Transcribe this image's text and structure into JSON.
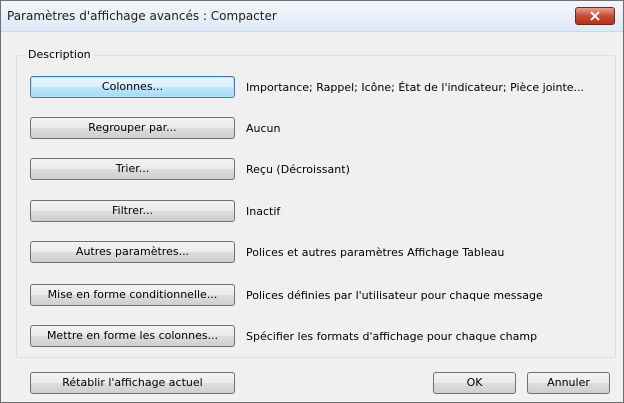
{
  "window": {
    "title": "Paramètres d'affichage avancés : Compacter"
  },
  "group": {
    "legend": "Description"
  },
  "rows": [
    {
      "button": "Colonnes...",
      "desc": "Importance; Rappel; Icône; État de l'indicateur; Pièce jointe..."
    },
    {
      "button": "Regrouper par...",
      "desc": "Aucun"
    },
    {
      "button": "Trier...",
      "desc": "Reçu (Décroissant)"
    },
    {
      "button": "Filtrer...",
      "desc": "Inactif"
    },
    {
      "button": "Autres paramètres...",
      "desc": "Polices et autres paramètres Affichage Tableau"
    },
    {
      "button": "Mise en forme conditionnelle...",
      "desc": "Polices définies par l'utilisateur pour chaque message"
    },
    {
      "button": "Mettre en forme les colonnes...",
      "desc": "Spécifier les formats d'affichage pour chaque champ"
    }
  ],
  "footer": {
    "reset": "Rétablir l'affichage actuel",
    "ok": "OK",
    "cancel": "Annuler"
  },
  "icons": {
    "close": "close-icon"
  },
  "colors": {
    "close_button": "#c74b34",
    "focus_border": "#3c7fb1"
  }
}
